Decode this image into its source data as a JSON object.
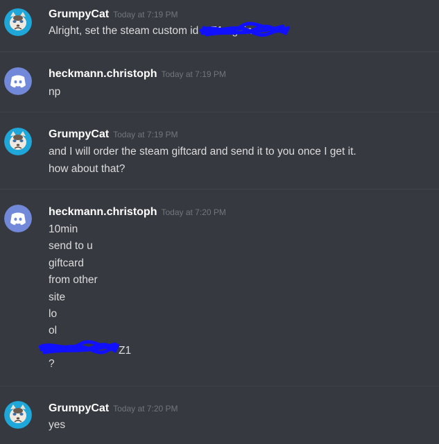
{
  "messages": [
    {
      "author": "GrumpyCat",
      "timestamp": "Today at 7:19 PM",
      "avatar_icon": "grumpy-cat-icon",
      "lines": [
        "Alright, set the steam custom id to",
        "Z1 again"
      ]
    },
    {
      "author": "heckmann.christoph",
      "timestamp": "Today at 7:19 PM",
      "avatar_icon": "discord-logo-icon",
      "lines": [
        "np"
      ]
    },
    {
      "author": "GrumpyCat",
      "timestamp": "Today at 7:19 PM",
      "avatar_icon": "grumpy-cat-icon",
      "lines": [
        "and I will order the steam giftcard and send it to you once I get it.",
        "how about that?"
      ]
    },
    {
      "author": "heckmann.christoph",
      "timestamp": "Today at 7:20 PM",
      "avatar_icon": "discord-logo-icon",
      "lines": [
        "10min",
        "send to u",
        "giftcard",
        "from other",
        "site",
        "lo",
        "ol",
        "Z1",
        "?"
      ]
    },
    {
      "author": "GrumpyCat",
      "timestamp": "Today at 7:20 PM",
      "avatar_icon": "grumpy-cat-icon",
      "lines": [
        "yes"
      ]
    }
  ],
  "colors": {
    "background": "#36393f",
    "discord_blurple": "#7289da",
    "grumpy_avatar_bg": "#1ea7d8",
    "redaction": "#1010ff"
  }
}
